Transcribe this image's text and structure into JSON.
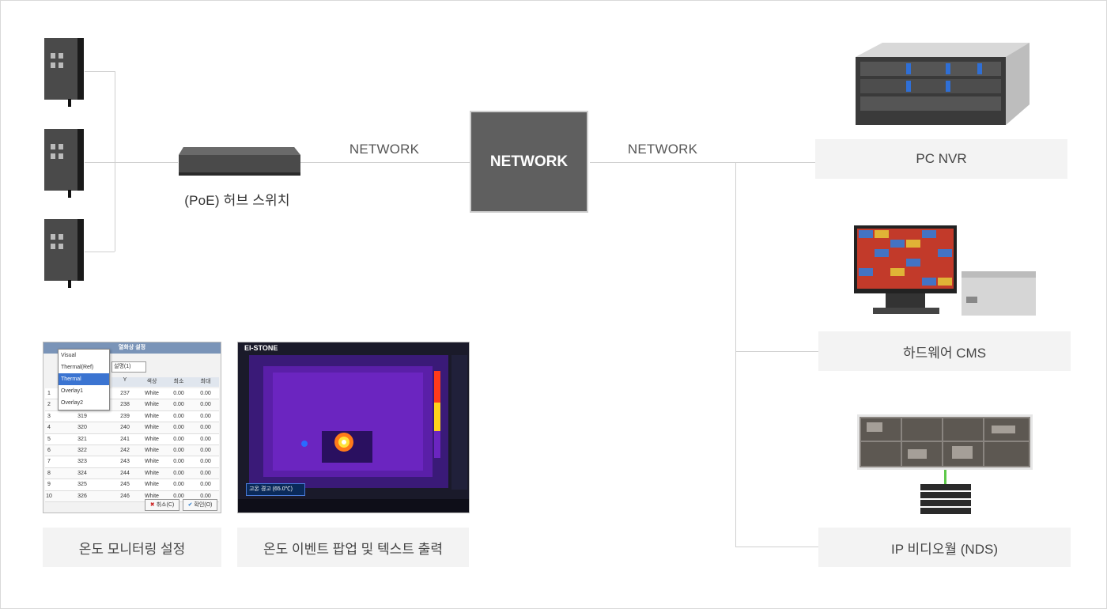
{
  "labels": {
    "network_left": "NETWORK",
    "network_right": "NETWORK",
    "network_center": "NETWORK",
    "switch": "(PoE) 허브 스위치"
  },
  "captions": {
    "pc_nvr": "PC NVR",
    "hw_cms": "하드웨어 CMS",
    "ip_videowall": "IP 비디오월 (NDS)",
    "temp_monitor": "온도 모니터링 설정",
    "temp_event": "온도 이벤트 팝업 및 텍스트 출력"
  },
  "settings_dialog": {
    "title": "열화상 설정",
    "dropdown_options": [
      "Visual",
      "Thermal(Ref)",
      "Thermal",
      "Overlay1",
      "Overlay2"
    ],
    "select_value": "설명(1)",
    "col_headers": [
      "Y",
      "색상",
      "최소",
      "최대"
    ],
    "rows": [
      {
        "n": "1",
        "x": "",
        "y": "237",
        "color": "White",
        "min": "0.00",
        "max": "0.00"
      },
      {
        "n": "2",
        "x": "",
        "y": "238",
        "color": "White",
        "min": "0.00",
        "max": "0.00"
      },
      {
        "n": "3",
        "x": "319",
        "y": "239",
        "color": "White",
        "min": "0.00",
        "max": "0.00"
      },
      {
        "n": "4",
        "x": "320",
        "y": "240",
        "color": "White",
        "min": "0.00",
        "max": "0.00"
      },
      {
        "n": "5",
        "x": "321",
        "y": "241",
        "color": "White",
        "min": "0.00",
        "max": "0.00"
      },
      {
        "n": "6",
        "x": "322",
        "y": "242",
        "color": "White",
        "min": "0.00",
        "max": "0.00"
      },
      {
        "n": "7",
        "x": "323",
        "y": "243",
        "color": "White",
        "min": "0.00",
        "max": "0.00"
      },
      {
        "n": "8",
        "x": "324",
        "y": "244",
        "color": "White",
        "min": "0.00",
        "max": "0.00"
      },
      {
        "n": "9",
        "x": "325",
        "y": "245",
        "color": "White",
        "min": "0.00",
        "max": "0.00"
      },
      {
        "n": "10",
        "x": "326",
        "y": "246",
        "color": "White",
        "min": "0.00",
        "max": "0.00"
      }
    ],
    "cancel_label": "취소(C)",
    "ok_label": "확인(O)"
  },
  "event_screen": {
    "logo": "EI-STONE",
    "alert_text": "고온 경고 (65.0℃)"
  },
  "colors": {
    "network_box": "#5f5f5f",
    "caption_bg": "#f3f3f3",
    "line": "#cfcfcf"
  }
}
